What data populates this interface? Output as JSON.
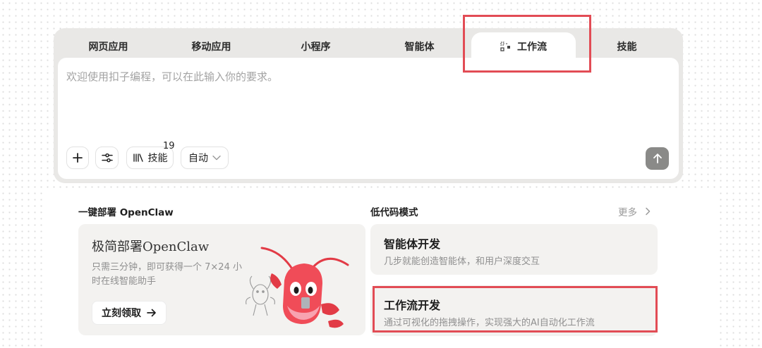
{
  "tabs": [
    {
      "label": "网页应用",
      "icon": ""
    },
    {
      "label": "移动应用",
      "icon": ""
    },
    {
      "label": "小程序",
      "icon": ""
    },
    {
      "label": "智能体",
      "icon": ""
    },
    {
      "label": "工作流",
      "icon": "workflow-icon",
      "active": true
    },
    {
      "label": "技能",
      "icon": ""
    }
  ],
  "prompt": {
    "placeholder": "欢迎使用扣子编程，可以在此输入你的要求。",
    "value": ""
  },
  "toolbar": {
    "add_icon": "plus-icon",
    "settings_icon": "sliders-icon",
    "skills_label": "技能",
    "skills_icon": "library-icon",
    "skills_count": "19",
    "mode_label": "自动",
    "mode_icon": "chevron-down-icon",
    "send_icon": "arrow-up-icon"
  },
  "deploy": {
    "heading": "一键部署 OpenClaw",
    "card_title": "极简部署OpenClaw",
    "card_desc": "只需三分钟，即可获得一个 7×24 小时在线智能助手",
    "cta_label": "立刻领取",
    "cta_icon": "arrow-right-icon"
  },
  "lowcode": {
    "heading": "低代码模式",
    "more_label": "更多",
    "more_icon": "chevron-right-icon",
    "items": [
      {
        "title": "智能体开发",
        "desc": "几步就能创造智能体，和用户深度交互"
      },
      {
        "title": "工作流开发",
        "desc": "通过可视化的拖拽操作，实现强大的AI自动化工作流",
        "highlighted": true
      }
    ]
  },
  "colors": {
    "highlight": "#e24c55",
    "card_bg": "#e9e8e6",
    "tile_bg": "#f3f2f0",
    "send_bg": "#8a8a88"
  }
}
